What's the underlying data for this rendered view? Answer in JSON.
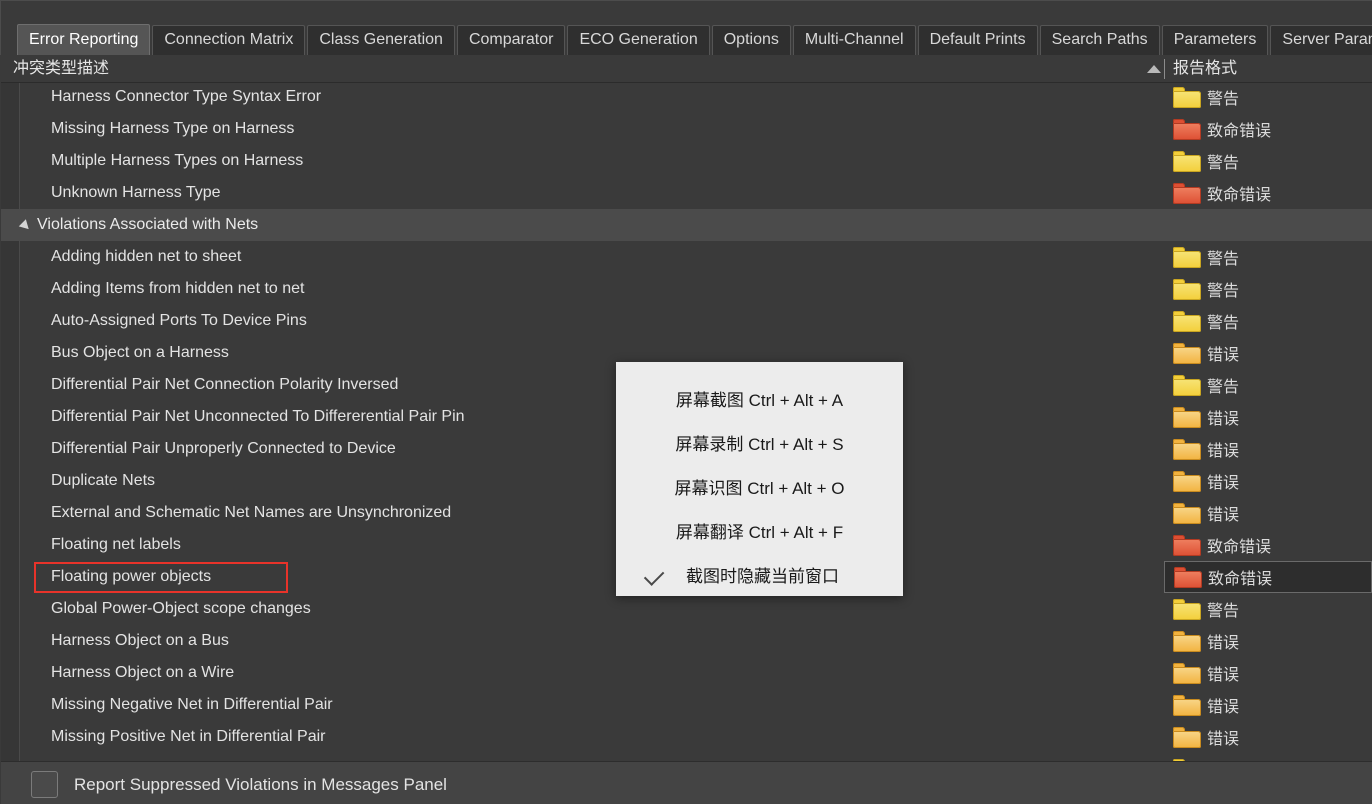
{
  "tabs": [
    {
      "label": "Error Reporting",
      "active": true
    },
    {
      "label": "Connection Matrix",
      "active": false
    },
    {
      "label": "Class Generation",
      "active": false
    },
    {
      "label": "Comparator",
      "active": false
    },
    {
      "label": "ECO Generation",
      "active": false
    },
    {
      "label": "Options",
      "active": false
    },
    {
      "label": "Multi-Channel",
      "active": false
    },
    {
      "label": "Default Prints",
      "active": false
    },
    {
      "label": "Search Paths",
      "active": false
    },
    {
      "label": "Parameters",
      "active": false
    },
    {
      "label": "Server Parameters",
      "active": false
    }
  ],
  "columns": {
    "description_header": "冲突类型描述",
    "format_header": "报告格式",
    "sort_icon": "sort-ascending-icon",
    "sort_direction": "ascending"
  },
  "rows": [
    {
      "label": "Harness Connector Type Syntax Error",
      "kind": "item",
      "format": "警告",
      "severity": "warning"
    },
    {
      "label": "Missing Harness Type on Harness",
      "kind": "item",
      "format": "致命错误",
      "severity": "fatal"
    },
    {
      "label": "Multiple Harness Types on Harness",
      "kind": "item",
      "format": "警告",
      "severity": "warning"
    },
    {
      "label": "Unknown Harness Type",
      "kind": "item",
      "format": "致命错误",
      "severity": "fatal"
    },
    {
      "label": "Violations Associated with Nets",
      "kind": "group",
      "format": "",
      "severity": "none"
    },
    {
      "label": "Adding hidden net to sheet",
      "kind": "item",
      "format": "警告",
      "severity": "warning"
    },
    {
      "label": "Adding Items from hidden net to net",
      "kind": "item",
      "format": "警告",
      "severity": "warning"
    },
    {
      "label": "Auto-Assigned Ports To Device Pins",
      "kind": "item",
      "format": "警告",
      "severity": "warning"
    },
    {
      "label": "Bus Object on a Harness",
      "kind": "item",
      "format": "错误",
      "severity": "error"
    },
    {
      "label": "Differential Pair Net Connection Polarity Inversed",
      "kind": "item",
      "format": "警告",
      "severity": "warning"
    },
    {
      "label": "Differential Pair Net Unconnected To Differerential Pair Pin",
      "kind": "item",
      "format": "错误",
      "severity": "error"
    },
    {
      "label": "Differential Pair Unproperly Connected to Device",
      "kind": "item",
      "format": "错误",
      "severity": "error"
    },
    {
      "label": "Duplicate Nets",
      "kind": "item",
      "format": "错误",
      "severity": "error"
    },
    {
      "label": "External and Schematic Net Names are Unsynchronized",
      "kind": "item",
      "format": "错误",
      "severity": "error"
    },
    {
      "label": "Floating net labels",
      "kind": "item",
      "format": "致命错误",
      "severity": "fatal"
    },
    {
      "label": "Floating power objects",
      "kind": "item",
      "format": "致命错误",
      "severity": "fatal",
      "highlighted": true,
      "selected": true
    },
    {
      "label": "Global Power-Object scope changes",
      "kind": "item",
      "format": "警告",
      "severity": "warning"
    },
    {
      "label": "Harness Object on a Bus",
      "kind": "item",
      "format": "错误",
      "severity": "error"
    },
    {
      "label": "Harness Object on a Wire",
      "kind": "item",
      "format": "错误",
      "severity": "error"
    },
    {
      "label": "Missing Negative Net in Differential Pair",
      "kind": "item",
      "format": "错误",
      "severity": "error"
    },
    {
      "label": "Missing Positive Net in Differential Pair",
      "kind": "item",
      "format": "错误",
      "severity": "error"
    },
    {
      "label": "",
      "kind": "item",
      "format": "警告",
      "severity": "warning",
      "clipped": true
    }
  ],
  "severity_colors": {
    "warning": {
      "light": "#f7e477",
      "dark": "#f3cf3a",
      "edge": "#c9a520"
    },
    "error": {
      "light": "#f8d68a",
      "dark": "#f2b33f",
      "edge": "#c98b1e"
    },
    "fatal": {
      "light": "#ef8060",
      "dark": "#dd4f33",
      "edge": "#b33a22"
    }
  },
  "highlight_color": "#e8332a",
  "bottom": {
    "checkbox_label": "Report Suppressed Violations in Messages Panel",
    "checkbox_checked": false
  },
  "context_menu": {
    "items": [
      {
        "label": "屏幕截图 Ctrl + Alt + A",
        "checked": false
      },
      {
        "label": "屏幕录制 Ctrl + Alt + S",
        "checked": false
      },
      {
        "label": "屏幕识图 Ctrl + Alt + O",
        "checked": false
      },
      {
        "label": "屏幕翻译 Ctrl + Alt + F",
        "checked": false
      },
      {
        "label": "截图时隐藏当前窗口",
        "checked": true
      }
    ]
  }
}
